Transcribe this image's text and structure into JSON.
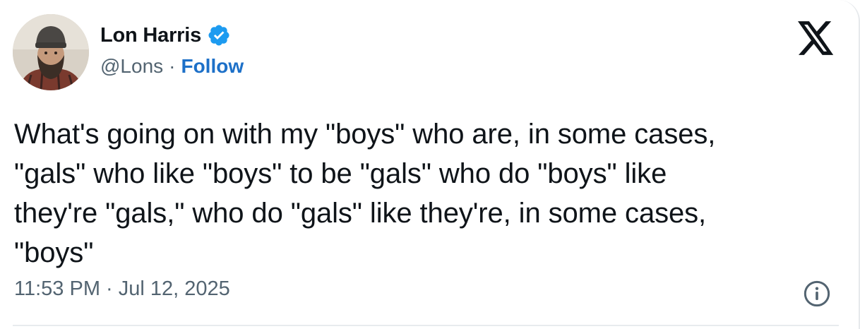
{
  "author": {
    "display_name": "Lon Harris",
    "handle": "@Lons",
    "separator": "·",
    "follow_label": "Follow",
    "verified": true
  },
  "tweet": {
    "text": "What's going on with my \"boys\" who are, in some cases,\n\"gals\" who like \"boys\" to be \"gals\" who do \"boys\" like\nthey're \"gals,\" who do \"gals\" like they're, in some cases,\n\"boys\"",
    "timestamp": "11:53 PM · Jul 12, 2025"
  },
  "icons": {
    "verified": "verified-badge-icon",
    "brand": "x-logo-icon",
    "info": "info-icon"
  },
  "colors": {
    "text_primary": "#0f1419",
    "text_secondary": "#536471",
    "link": "#1d70c8",
    "verified": "#1d9bf0"
  }
}
